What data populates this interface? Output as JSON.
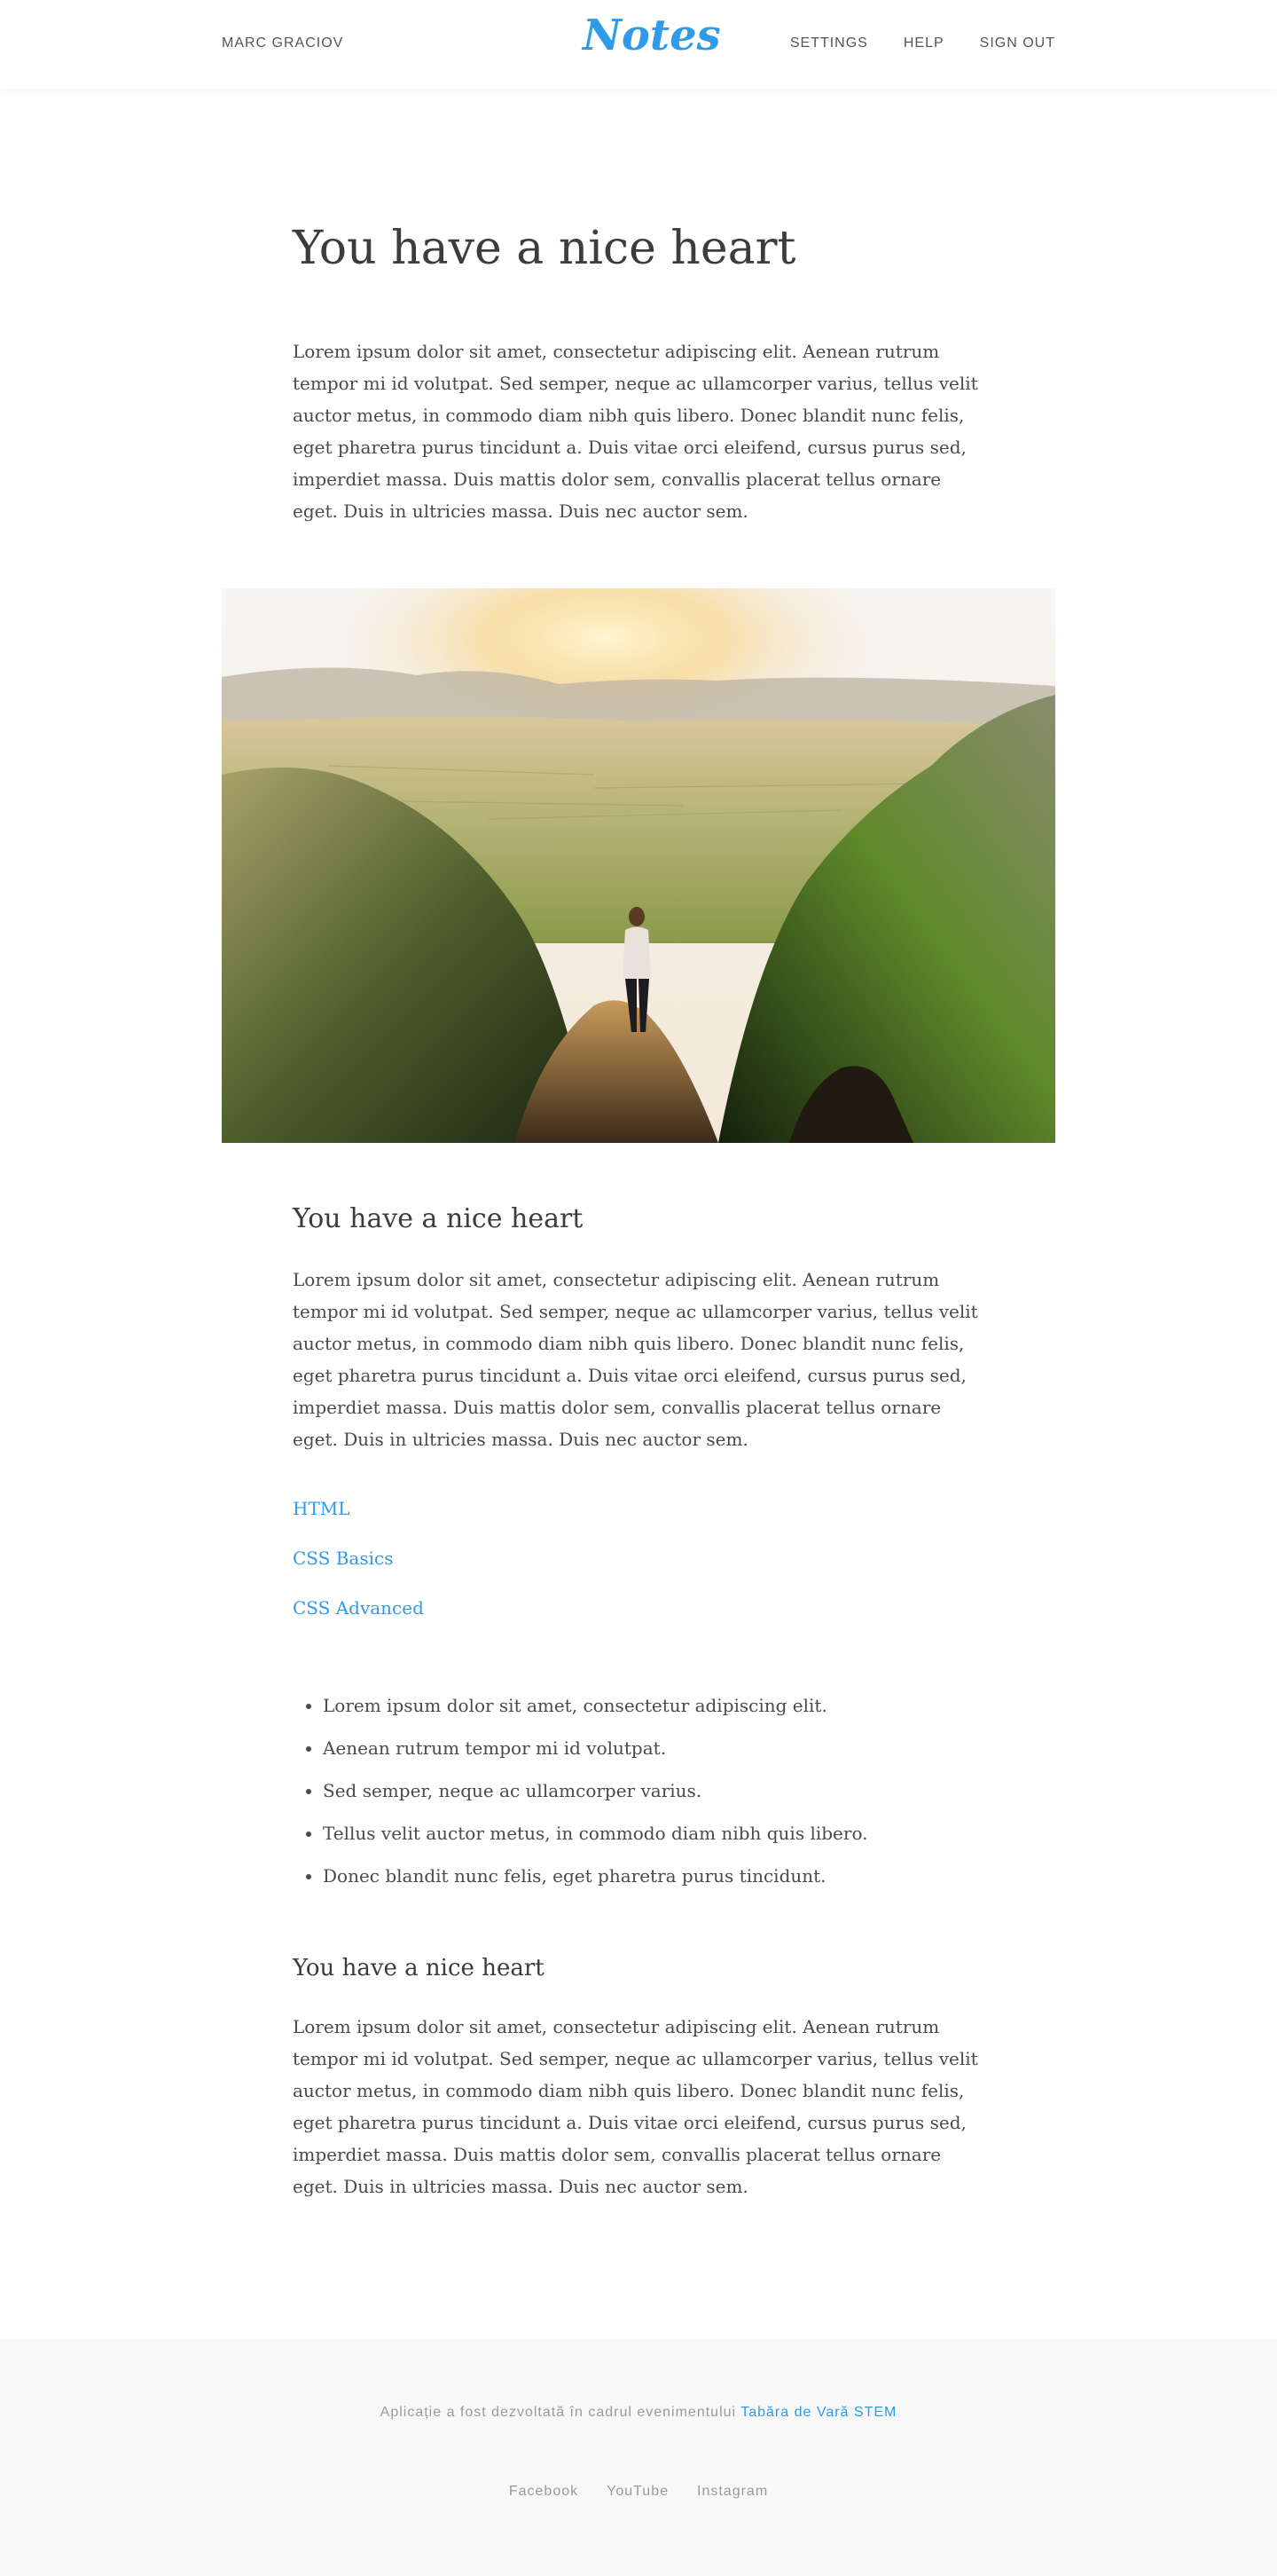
{
  "header": {
    "user_name": "MARC GRACIOV",
    "logo": "Notes",
    "nav": [
      "SETTINGS",
      "HELP",
      "SIGN OUT"
    ]
  },
  "article": {
    "title": "You have a nice heart",
    "paragraph": "Lorem ipsum dolor sit amet, consectetur adipiscing elit. Aenean rutrum tempor mi id volutpat. Sed semper, neque ac ullamcorper varius, tellus velit auctor metus, in commodo diam nibh quis libero. Donec blandit nunc felis, eget pharetra purus tincidunt a. Duis vitae orci eleifend, cursus purus sed, imperdiet massa. Duis mattis dolor sem, convallis placerat tellus ornare eget. Duis in ultricies massa. Duis nec auctor sem.",
    "section1_title": "You have a nice heart",
    "links": [
      "HTML",
      "CSS Basics",
      "CSS Advanced"
    ],
    "bullets": [
      "Lorem ipsum dolor sit amet, consectetur adipiscing elit.",
      "Aenean rutrum tempor mi id volutpat.",
      "Sed semper, neque ac ullamcorper varius.",
      "Tellus velit auctor metus, in commodo diam nibh quis libero.",
      "Donec blandit nunc felis, eget pharetra purus tincidunt."
    ],
    "section2_title": "You have a nice heart"
  },
  "footer": {
    "credit_text": "Aplicație a fost dezvoltată în cadrul evenimentului",
    "credit_link": "Tabăra de Vară STEM",
    "social": [
      "Facebook",
      "YouTube",
      "Instagram"
    ]
  },
  "colors": {
    "accent": "#2f9be8",
    "text": "#4a4a4a",
    "footer_bg": "#f8f8f8"
  }
}
